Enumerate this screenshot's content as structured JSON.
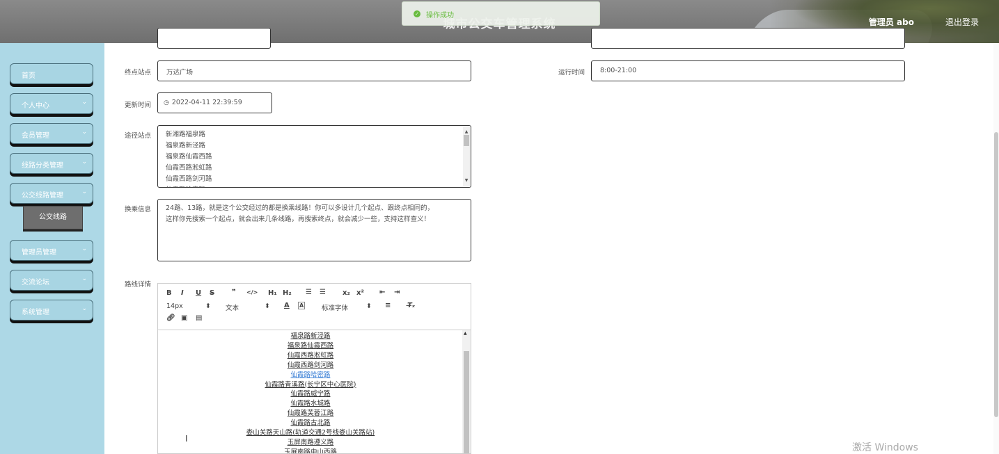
{
  "header": {
    "title": "城市公交车管理系统",
    "user": "管理员 abo",
    "logout": "退出登录"
  },
  "toast": {
    "message": "操作成功"
  },
  "sidebar": {
    "items": [
      {
        "label": "首页",
        "has_submenu": false
      },
      {
        "label": "个人中心",
        "has_submenu": true
      },
      {
        "label": "会员管理",
        "has_submenu": true
      },
      {
        "label": "线路分类管理",
        "has_submenu": true
      },
      {
        "label": "公交线路管理",
        "has_submenu": true
      },
      {
        "label": "管理员管理",
        "has_submenu": true
      },
      {
        "label": "交流论坛",
        "has_submenu": true
      },
      {
        "label": "系统管理",
        "has_submenu": true
      }
    ],
    "active_sub": "公交线路",
    "chevron": "⌄"
  },
  "form": {
    "end_station": {
      "label": "终点站点",
      "value": "万达广场"
    },
    "run_time": {
      "label": "运行时间",
      "value": "8:00-21:00"
    },
    "update_time": {
      "label": "更新时间",
      "value": "2022-04-11 22:39:59"
    },
    "via_stations": {
      "label": "途径站点",
      "lines": [
        "新湘路福泉路",
        "福泉路新泾路",
        "福泉路仙霞西路",
        "仙霞西路淞虹路",
        "仙霞西路剑河路",
        "仙霞路哈密路"
      ]
    },
    "transfer": {
      "label": "换乘信息",
      "lines": [
        "24路、13路，就是这个公交经过的都是换乘线路！你可以多设计几个起点、跟终点相同的，",
        "这样你先搜索一个起点，就会出来几条线路，再搜索终点，就会减少一些，支持这样查义！"
      ]
    },
    "detail": {
      "label": "路线详情",
      "toolbar": {
        "font_size": "14px",
        "text_type": "文本",
        "font_family": "标准字体"
      },
      "lines": [
        {
          "text": "福泉路新泾路",
          "link": false
        },
        {
          "text": "福泉路仙霞西路",
          "link": false
        },
        {
          "text": "仙霞西路淞虹路",
          "link": false
        },
        {
          "text": "仙霞西路剑河路",
          "link": false
        },
        {
          "text": "仙霞路哈密路",
          "link": true
        },
        {
          "text": "仙霞路青溪路(长宁区中心医院)",
          "link": false
        },
        {
          "text": "仙霞路威宁路",
          "link": false
        },
        {
          "text": "仙霞路水城路",
          "link": false
        },
        {
          "text": "仙霞路芙蓉江路",
          "link": false
        },
        {
          "text": "仙霞路古北路",
          "link": false
        },
        {
          "text": "娄山关路天山路(轨道交通2号线娄山关路站)",
          "link": false
        },
        {
          "text": "玉屏南路遵义路",
          "link": false
        },
        {
          "text": "玉屏南路中山西路",
          "link": false
        }
      ]
    }
  },
  "watermark": "激活 Windows"
}
